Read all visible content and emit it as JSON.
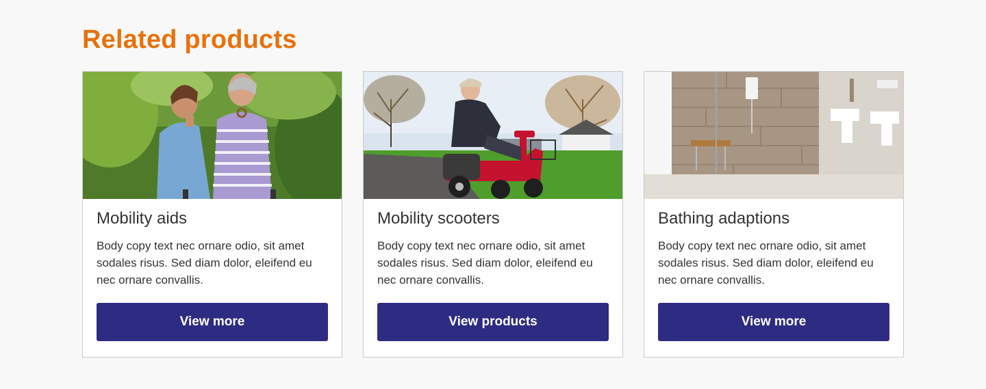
{
  "section": {
    "title": "Related products"
  },
  "colors": {
    "accent": "#e8710a",
    "button": "#2e2b82",
    "text": "#333333",
    "card_border": "#c9c9c9",
    "background": "#f8f8f8"
  },
  "cards": [
    {
      "image_name": "mobility-aids-photo",
      "title": "Mobility aids",
      "body": "Body copy text nec ornare odio, sit amet sodales risus. Sed diam dolor, eleifend eu nec ornare convallis.",
      "button_label": "View more"
    },
    {
      "image_name": "mobility-scooter-photo",
      "title": "Mobility scooters",
      "body": "Body copy text nec ornare odio, sit amet sodales risus. Sed diam dolor, eleifend eu nec ornare convallis.",
      "button_label": "View products"
    },
    {
      "image_name": "bathroom-photo",
      "title": "Bathing adaptions",
      "body": "Body copy text nec ornare odio, sit amet sodales risus. Sed diam dolor, eleifend eu nec ornare convallis.",
      "button_label": "View more"
    }
  ]
}
